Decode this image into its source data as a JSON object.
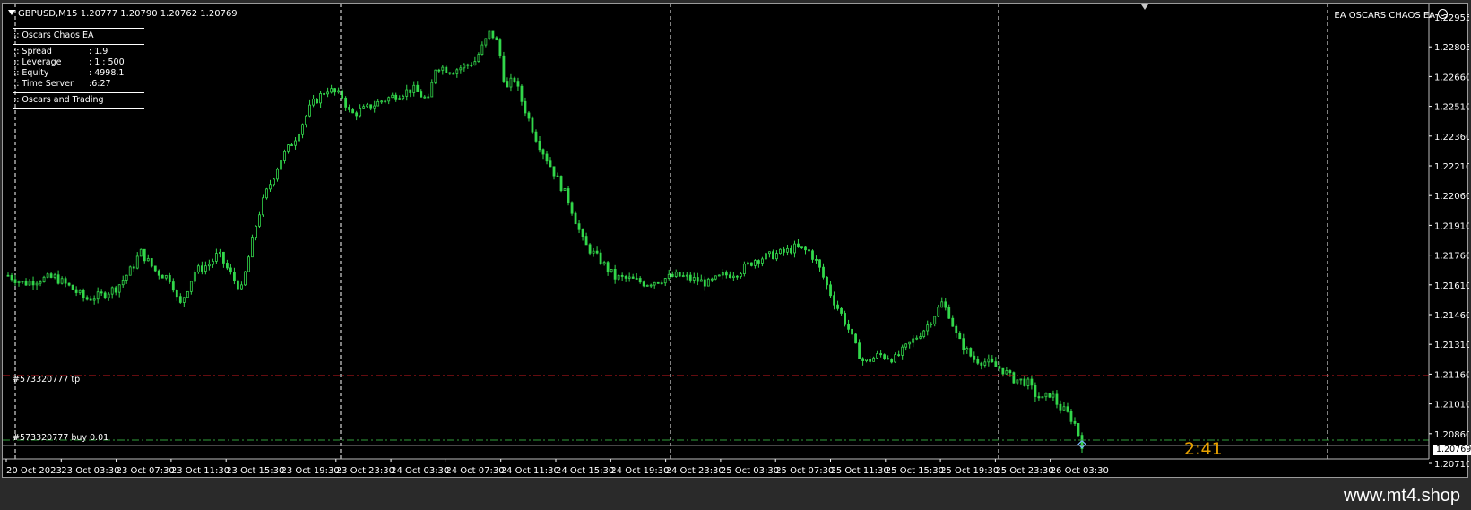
{
  "header": {
    "symbol_info": "GBPUSD,M15  1.20777 1.20790 1.20762 1.20769"
  },
  "ea_panel": {
    "title": ":: Oscars Chaos EA",
    "spread_label": ":: Spread",
    "spread_value": ": 1.9",
    "leverage_label": ":: Leverage",
    "leverage_value": ": 1 : 500",
    "equity_label": ":: Equity",
    "equity_value": ": 4998.1",
    "time_label": ":: Time Server",
    "time_value": ":6:27",
    "footer": ":: Oscars and Trading"
  },
  "ea_name": "EA OSCARS CHAOS EA",
  "orders": {
    "tp_label": "#573320777 tp",
    "buy_label": "#573320777 buy 0.01"
  },
  "timer": "2:41",
  "current_price": "1.20769",
  "watermark": "www.mt4.shop",
  "colors": {
    "candle": "#32d74b",
    "tp_line": "#c8181e",
    "buy_line": "#2f9e3a",
    "timer": "#e8a200",
    "grid": "#ffffff"
  },
  "chart_data": {
    "type": "candlestick",
    "symbol": "GBPUSD",
    "timeframe": "M15",
    "y_ticks": [
      "1.22955",
      "1.22805",
      "1.22660",
      "1.22510",
      "1.22360",
      "1.22210",
      "1.22060",
      "1.21910",
      "1.21760",
      "1.21610",
      "1.21460",
      "1.21310",
      "1.21160",
      "1.21010",
      "1.20860",
      "1.20710"
    ],
    "ylim": [
      1.20695,
      1.2299
    ],
    "x_ticks": [
      "20 Oct 2023",
      "23 Oct 03:30",
      "23 Oct 07:30",
      "23 Oct 11:30",
      "23 Oct 15:30",
      "23 Oct 19:30",
      "23 Oct 23:30",
      "24 Oct 03:30",
      "24 Oct 07:30",
      "24 Oct 11:30",
      "24 Oct 15:30",
      "24 Oct 19:30",
      "24 Oct 23:30",
      "25 Oct 03:30",
      "25 Oct 07:30",
      "25 Oct 11:30",
      "25 Oct 15:30",
      "25 Oct 19:30",
      "25 Oct 23:30",
      "26 Oct 03:30"
    ],
    "tp_level": 1.21115,
    "buy_level": 1.2079,
    "close_path": [
      [
        0,
        1.2162
      ],
      [
        4,
        1.2158
      ],
      [
        8,
        1.216
      ],
      [
        12,
        1.2161
      ],
      [
        16,
        1.2156
      ],
      [
        20,
        1.215
      ],
      [
        24,
        1.2152
      ],
      [
        28,
        1.2156
      ],
      [
        32,
        1.2166
      ],
      [
        34,
        1.2174
      ],
      [
        38,
        1.2164
      ],
      [
        42,
        1.216
      ],
      [
        44,
        1.2146
      ],
      [
        48,
        1.2164
      ],
      [
        52,
        1.2168
      ],
      [
        54,
        1.2173
      ],
      [
        58,
        1.216
      ],
      [
        60,
        1.2155
      ],
      [
        64,
        1.219
      ],
      [
        66,
        1.2202
      ],
      [
        70,
        1.222
      ],
      [
        74,
        1.2232
      ],
      [
        78,
        1.2248
      ],
      [
        82,
        1.2256
      ],
      [
        86,
        1.2252
      ],
      [
        88,
        1.2243
      ],
      [
        92,
        1.2246
      ],
      [
        96,
        1.225
      ],
      [
        100,
        1.2253
      ],
      [
        104,
        1.2256
      ],
      [
        108,
        1.225
      ],
      [
        110,
        1.2268
      ],
      [
        114,
        1.2265
      ],
      [
        118,
        1.2268
      ],
      [
        120,
        1.227
      ],
      [
        124,
        1.2285
      ],
      [
        126,
        1.2278
      ],
      [
        128,
        1.2255
      ],
      [
        130,
        1.2262
      ],
      [
        132,
        1.225
      ],
      [
        136,
        1.223
      ],
      [
        140,
        1.2215
      ],
      [
        144,
        1.22
      ],
      [
        148,
        1.2178
      ],
      [
        152,
        1.217
      ],
      [
        156,
        1.2161
      ],
      [
        160,
        1.216
      ],
      [
        164,
        1.2158
      ],
      [
        168,
        1.216
      ],
      [
        172,
        1.2162
      ],
      [
        176,
        1.216
      ],
      [
        180,
        1.2158
      ],
      [
        184,
        1.2162
      ],
      [
        188,
        1.2164
      ],
      [
        192,
        1.217
      ],
      [
        196,
        1.2172
      ],
      [
        200,
        1.2174
      ],
      [
        202,
        1.2176
      ],
      [
        206,
        1.2174
      ],
      [
        208,
        1.2168
      ],
      [
        212,
        1.215
      ],
      [
        214,
        1.2143
      ],
      [
        216,
        1.2135
      ],
      [
        218,
        1.2125
      ],
      [
        220,
        1.2118
      ],
      [
        224,
        1.2122
      ],
      [
        228,
        1.212
      ],
      [
        232,
        1.2128
      ],
      [
        236,
        1.2136
      ],
      [
        238,
        1.2142
      ],
      [
        240,
        1.2148
      ],
      [
        242,
        1.2142
      ],
      [
        244,
        1.213
      ],
      [
        248,
        1.212
      ],
      [
        252,
        1.2118
      ],
      [
        256,
        1.2114
      ],
      [
        258,
        1.211
      ],
      [
        262,
        1.2108
      ],
      [
        264,
        1.2102
      ],
      [
        266,
        1.2099
      ],
      [
        268,
        1.2103
      ],
      [
        270,
        1.2096
      ],
      [
        272,
        1.2093
      ],
      [
        274,
        1.2088
      ],
      [
        276,
        1.20769
      ]
    ]
  }
}
